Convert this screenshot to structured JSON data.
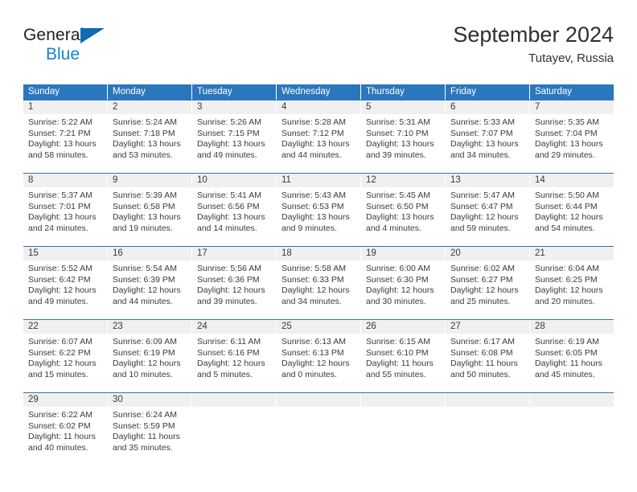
{
  "brand": {
    "name_line1": "General",
    "name_line2": "Blue",
    "primary_color": "#0d6cb6",
    "accent_color": "#1481d4"
  },
  "header": {
    "title": "September 2024",
    "subtitle": "Tutayev, Russia"
  },
  "calendar": {
    "header_color": "#2b77bd",
    "daynumber_band_color": "#f0f0f0",
    "weekdays": [
      "Sunday",
      "Monday",
      "Tuesday",
      "Wednesday",
      "Thursday",
      "Friday",
      "Saturday"
    ],
    "weeks": [
      [
        {
          "day": "1",
          "sunrise": "Sunrise: 5:22 AM",
          "sunset": "Sunset: 7:21 PM",
          "daylight_line1": "Daylight: 13 hours",
          "daylight_line2": "and 58 minutes."
        },
        {
          "day": "2",
          "sunrise": "Sunrise: 5:24 AM",
          "sunset": "Sunset: 7:18 PM",
          "daylight_line1": "Daylight: 13 hours",
          "daylight_line2": "and 53 minutes."
        },
        {
          "day": "3",
          "sunrise": "Sunrise: 5:26 AM",
          "sunset": "Sunset: 7:15 PM",
          "daylight_line1": "Daylight: 13 hours",
          "daylight_line2": "and 49 minutes."
        },
        {
          "day": "4",
          "sunrise": "Sunrise: 5:28 AM",
          "sunset": "Sunset: 7:12 PM",
          "daylight_line1": "Daylight: 13 hours",
          "daylight_line2": "and 44 minutes."
        },
        {
          "day": "5",
          "sunrise": "Sunrise: 5:31 AM",
          "sunset": "Sunset: 7:10 PM",
          "daylight_line1": "Daylight: 13 hours",
          "daylight_line2": "and 39 minutes."
        },
        {
          "day": "6",
          "sunrise": "Sunrise: 5:33 AM",
          "sunset": "Sunset: 7:07 PM",
          "daylight_line1": "Daylight: 13 hours",
          "daylight_line2": "and 34 minutes."
        },
        {
          "day": "7",
          "sunrise": "Sunrise: 5:35 AM",
          "sunset": "Sunset: 7:04 PM",
          "daylight_line1": "Daylight: 13 hours",
          "daylight_line2": "and 29 minutes."
        }
      ],
      [
        {
          "day": "8",
          "sunrise": "Sunrise: 5:37 AM",
          "sunset": "Sunset: 7:01 PM",
          "daylight_line1": "Daylight: 13 hours",
          "daylight_line2": "and 24 minutes."
        },
        {
          "day": "9",
          "sunrise": "Sunrise: 5:39 AM",
          "sunset": "Sunset: 6:58 PM",
          "daylight_line1": "Daylight: 13 hours",
          "daylight_line2": "and 19 minutes."
        },
        {
          "day": "10",
          "sunrise": "Sunrise: 5:41 AM",
          "sunset": "Sunset: 6:56 PM",
          "daylight_line1": "Daylight: 13 hours",
          "daylight_line2": "and 14 minutes."
        },
        {
          "day": "11",
          "sunrise": "Sunrise: 5:43 AM",
          "sunset": "Sunset: 6:53 PM",
          "daylight_line1": "Daylight: 13 hours",
          "daylight_line2": "and 9 minutes."
        },
        {
          "day": "12",
          "sunrise": "Sunrise: 5:45 AM",
          "sunset": "Sunset: 6:50 PM",
          "daylight_line1": "Daylight: 13 hours",
          "daylight_line2": "and 4 minutes."
        },
        {
          "day": "13",
          "sunrise": "Sunrise: 5:47 AM",
          "sunset": "Sunset: 6:47 PM",
          "daylight_line1": "Daylight: 12 hours",
          "daylight_line2": "and 59 minutes."
        },
        {
          "day": "14",
          "sunrise": "Sunrise: 5:50 AM",
          "sunset": "Sunset: 6:44 PM",
          "daylight_line1": "Daylight: 12 hours",
          "daylight_line2": "and 54 minutes."
        }
      ],
      [
        {
          "day": "15",
          "sunrise": "Sunrise: 5:52 AM",
          "sunset": "Sunset: 6:42 PM",
          "daylight_line1": "Daylight: 12 hours",
          "daylight_line2": "and 49 minutes."
        },
        {
          "day": "16",
          "sunrise": "Sunrise: 5:54 AM",
          "sunset": "Sunset: 6:39 PM",
          "daylight_line1": "Daylight: 12 hours",
          "daylight_line2": "and 44 minutes."
        },
        {
          "day": "17",
          "sunrise": "Sunrise: 5:56 AM",
          "sunset": "Sunset: 6:36 PM",
          "daylight_line1": "Daylight: 12 hours",
          "daylight_line2": "and 39 minutes."
        },
        {
          "day": "18",
          "sunrise": "Sunrise: 5:58 AM",
          "sunset": "Sunset: 6:33 PM",
          "daylight_line1": "Daylight: 12 hours",
          "daylight_line2": "and 34 minutes."
        },
        {
          "day": "19",
          "sunrise": "Sunrise: 6:00 AM",
          "sunset": "Sunset: 6:30 PM",
          "daylight_line1": "Daylight: 12 hours",
          "daylight_line2": "and 30 minutes."
        },
        {
          "day": "20",
          "sunrise": "Sunrise: 6:02 AM",
          "sunset": "Sunset: 6:27 PM",
          "daylight_line1": "Daylight: 12 hours",
          "daylight_line2": "and 25 minutes."
        },
        {
          "day": "21",
          "sunrise": "Sunrise: 6:04 AM",
          "sunset": "Sunset: 6:25 PM",
          "daylight_line1": "Daylight: 12 hours",
          "daylight_line2": "and 20 minutes."
        }
      ],
      [
        {
          "day": "22",
          "sunrise": "Sunrise: 6:07 AM",
          "sunset": "Sunset: 6:22 PM",
          "daylight_line1": "Daylight: 12 hours",
          "daylight_line2": "and 15 minutes."
        },
        {
          "day": "23",
          "sunrise": "Sunrise: 6:09 AM",
          "sunset": "Sunset: 6:19 PM",
          "daylight_line1": "Daylight: 12 hours",
          "daylight_line2": "and 10 minutes."
        },
        {
          "day": "24",
          "sunrise": "Sunrise: 6:11 AM",
          "sunset": "Sunset: 6:16 PM",
          "daylight_line1": "Daylight: 12 hours",
          "daylight_line2": "and 5 minutes."
        },
        {
          "day": "25",
          "sunrise": "Sunrise: 6:13 AM",
          "sunset": "Sunset: 6:13 PM",
          "daylight_line1": "Daylight: 12 hours",
          "daylight_line2": "and 0 minutes."
        },
        {
          "day": "26",
          "sunrise": "Sunrise: 6:15 AM",
          "sunset": "Sunset: 6:10 PM",
          "daylight_line1": "Daylight: 11 hours",
          "daylight_line2": "and 55 minutes."
        },
        {
          "day": "27",
          "sunrise": "Sunrise: 6:17 AM",
          "sunset": "Sunset: 6:08 PM",
          "daylight_line1": "Daylight: 11 hours",
          "daylight_line2": "and 50 minutes."
        },
        {
          "day": "28",
          "sunrise": "Sunrise: 6:19 AM",
          "sunset": "Sunset: 6:05 PM",
          "daylight_line1": "Daylight: 11 hours",
          "daylight_line2": "and 45 minutes."
        }
      ],
      [
        {
          "day": "29",
          "sunrise": "Sunrise: 6:22 AM",
          "sunset": "Sunset: 6:02 PM",
          "daylight_line1": "Daylight: 11 hours",
          "daylight_line2": "and 40 minutes."
        },
        {
          "day": "30",
          "sunrise": "Sunrise: 6:24 AM",
          "sunset": "Sunset: 5:59 PM",
          "daylight_line1": "Daylight: 11 hours",
          "daylight_line2": "and 35 minutes."
        },
        {
          "day": "",
          "sunrise": "",
          "sunset": "",
          "daylight_line1": "",
          "daylight_line2": ""
        },
        {
          "day": "",
          "sunrise": "",
          "sunset": "",
          "daylight_line1": "",
          "daylight_line2": ""
        },
        {
          "day": "",
          "sunrise": "",
          "sunset": "",
          "daylight_line1": "",
          "daylight_line2": ""
        },
        {
          "day": "",
          "sunrise": "",
          "sunset": "",
          "daylight_line1": "",
          "daylight_line2": ""
        },
        {
          "day": "",
          "sunrise": "",
          "sunset": "",
          "daylight_line1": "",
          "daylight_line2": ""
        }
      ]
    ]
  }
}
